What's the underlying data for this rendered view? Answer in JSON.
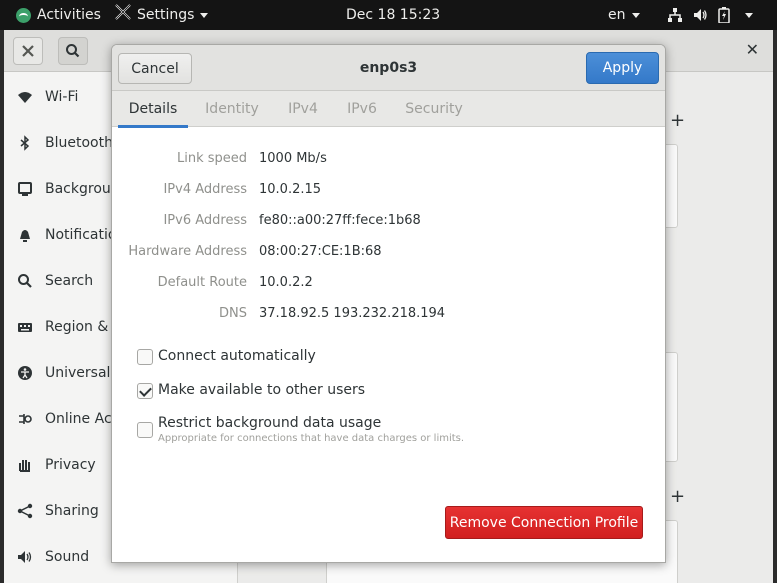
{
  "topbar": {
    "activities": "Activities",
    "app_menu": "Settings",
    "clock": "Dec 18  15:23",
    "input_source": "en"
  },
  "settings": {
    "sidebar": {
      "items": [
        {
          "label": "Wi-Fi",
          "icon": "wifi-icon"
        },
        {
          "label": "Bluetooth",
          "icon": "bluetooth-icon"
        },
        {
          "label": "Backgroun",
          "icon": "background-icon"
        },
        {
          "label": "Notification",
          "icon": "bell-icon"
        },
        {
          "label": "Search",
          "icon": "search-icon"
        },
        {
          "label": "Region & L",
          "icon": "keyboard-icon"
        },
        {
          "label": "Universal A",
          "icon": "accessibility-icon"
        },
        {
          "label": "Online Acc",
          "icon": "online-accounts-icon"
        },
        {
          "label": "Privacy",
          "icon": "hand-icon"
        },
        {
          "label": "Sharing",
          "icon": "share-icon"
        },
        {
          "label": "Sound",
          "icon": "speaker-icon"
        }
      ]
    }
  },
  "dialog": {
    "title": "enp0s3",
    "cancel_label": "Cancel",
    "apply_label": "Apply",
    "tabs": [
      {
        "label": "Details",
        "active": true
      },
      {
        "label": "Identity",
        "active": false
      },
      {
        "label": "IPv4",
        "active": false
      },
      {
        "label": "IPv6",
        "active": false
      },
      {
        "label": "Security",
        "active": false
      }
    ],
    "details": [
      {
        "label": "Link speed",
        "value": "1000 Mb/s"
      },
      {
        "label": "IPv4 Address",
        "value": "10.0.2.15"
      },
      {
        "label": "IPv6 Address",
        "value": "fe80::a00:27ff:fece:1b68"
      },
      {
        "label": "Hardware Address",
        "value": "08:00:27:CE:1B:68"
      },
      {
        "label": "Default Route",
        "value": "10.0.2.2"
      },
      {
        "label": "DNS",
        "value": "37.18.92.5 193.232.218.194"
      }
    ],
    "options": {
      "connect_automatically": {
        "label": "Connect automatically",
        "checked": false
      },
      "available_to_all": {
        "label": "Make available to other users",
        "checked": true
      },
      "restrict_background": {
        "label": "Restrict background data usage",
        "description": "Appropriate for connections that have data charges or limits.",
        "checked": false
      }
    },
    "remove_label": "Remove Connection Profile"
  },
  "colors": {
    "topbar_bg": "#141414",
    "accent_blue": "#3479c9",
    "destructive_red": "#d11f1f",
    "activities_logo": "#3ca06a"
  }
}
